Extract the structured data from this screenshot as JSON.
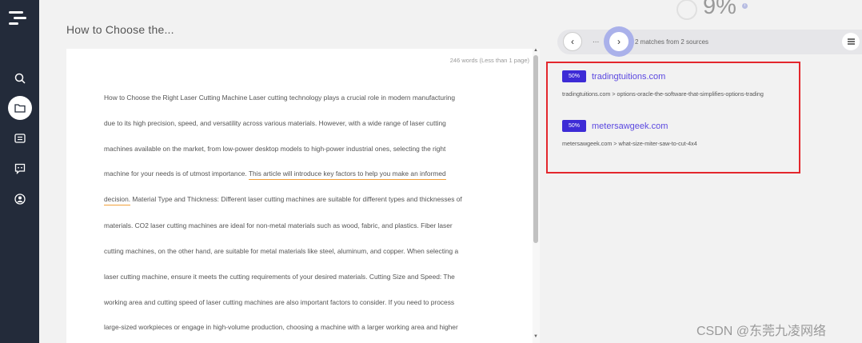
{
  "sidebar": {
    "logo_icon": "hamburger-logo",
    "items": [
      {
        "icon": "search-icon"
      },
      {
        "icon": "folder-icon",
        "active": true
      },
      {
        "icon": "list-icon"
      },
      {
        "icon": "chat-icon"
      },
      {
        "icon": "user-icon"
      }
    ]
  },
  "document": {
    "title": "How to Choose the...",
    "word_count": "246 words (Less than 1 page)",
    "lines": [
      {
        "text": "How to Choose the Right Laser Cutting Machine Laser cutting technology plays a crucial role in modern manufacturing"
      },
      {
        "text": "due to its high precision, speed, and versatility across various materials. However, with a wide range of laser cutting"
      },
      {
        "text": "machines available on the market, from low-power desktop models to high-power industrial ones, selecting the right"
      },
      {
        "pre": "machine for your needs is of utmost importance. ",
        "hl": "This article will introduce key factors to help you make an informed",
        "post": ""
      },
      {
        "pre": "",
        "hl": "decision.",
        "post": " Material Type and Thickness: Different laser cutting machines are suitable for different types and thicknesses of"
      },
      {
        "text": "materials. CO2 laser cutting machines are ideal for non-metal materials such as wood, fabric, and plastics. Fiber laser"
      },
      {
        "text": "cutting machines, on the other hand, are suitable for metal materials like steel, aluminum, and copper. When selecting a"
      },
      {
        "text": "laser cutting machine, ensure it meets the cutting requirements of your desired materials. Cutting Size and Speed: The"
      },
      {
        "text": "working area and cutting speed of laser cutting machines are also important factors to consider. If you need to process"
      },
      {
        "text": "large-sized workpieces or engage in high-volume production, choosing a machine with a larger working area and higher"
      }
    ]
  },
  "score": {
    "value": "9%",
    "info_icon": "info-icon"
  },
  "matches": {
    "prev_symbol": "‹",
    "dots": "...",
    "next_symbol": "›",
    "summary": "2 matches from 2 sources",
    "menu_icon": "menu-icon"
  },
  "sources": [
    {
      "percent": "50%",
      "domain": "tradingtuitions.com",
      "path": "tradingtuitions.com > options-oracle-the-software-that-simplifies-options-trading"
    },
    {
      "percent": "50%",
      "domain": "metersawgeek.com",
      "path": "metersawgeek.com > what-size-miter-saw-to-cut-4x4"
    }
  ],
  "watermark": "CSDN @东莞九凌网络",
  "colors": {
    "sidebar": "#232b3a",
    "accent": "#3d2bd6",
    "highlight": "#f2a13a",
    "frame": "#e3272d"
  }
}
